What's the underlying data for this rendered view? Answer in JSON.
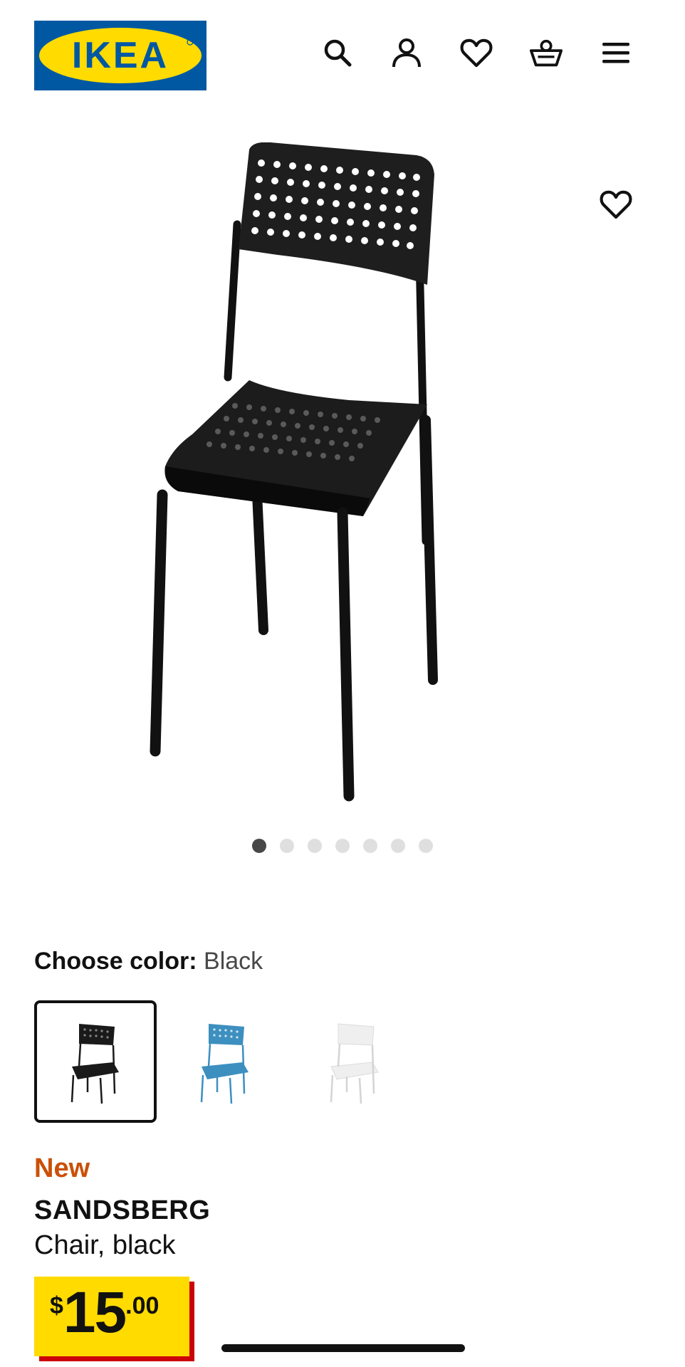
{
  "header": {
    "logo_text": "IKEA",
    "icons": [
      "search-icon",
      "user-icon",
      "heart-icon",
      "basket-icon",
      "menu-icon"
    ]
  },
  "gallery": {
    "image": "black-chair-photo",
    "favorite_icon": "heart-icon",
    "dots_total": 7,
    "active_dot": 1
  },
  "color": {
    "label": "Choose color:",
    "value": " Black",
    "options": [
      {
        "name": "black",
        "hex": "#1a1a1a",
        "selected": true
      },
      {
        "name": "blue",
        "hex": "#3d8fbf",
        "selected": false
      },
      {
        "name": "white",
        "hex": "#ececec",
        "selected": false
      }
    ]
  },
  "product": {
    "badge": "New",
    "name": "SANDSBERG",
    "description": "Chair, black"
  },
  "price": {
    "currency": "$",
    "integer": "15",
    "decimal": ".00"
  },
  "colors": {
    "brand_blue": "#0058a3",
    "brand_yellow": "#ffdb00",
    "price_shadow_red": "#cc0008",
    "new_badge_orange": "#ca5008"
  }
}
